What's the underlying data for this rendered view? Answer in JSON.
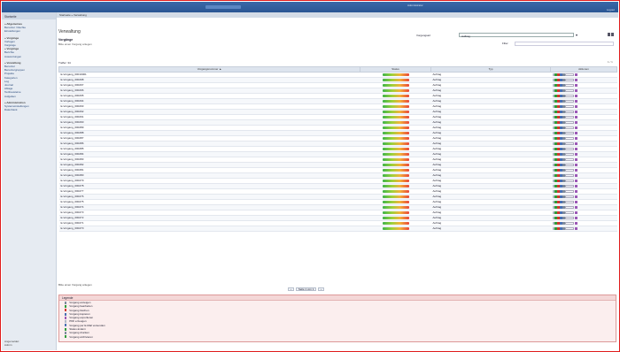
{
  "header": {
    "center_badge": "",
    "user_line1": "Administrator",
    "user_line2": "",
    "right_line1": "",
    "right_line2": "Logout"
  },
  "sidebar": {
    "head": "Startseite",
    "groups": [
      {
        "items": [
          "» Allgemeines",
          "Benutzer / Rechte",
          "Einstellungen"
        ]
      },
      {
        "items": [
          "» Vorgänge",
          "Vorlagen",
          "Vorgänge",
          "» Vorgänge",
          "Berichte",
          "Auswertungen"
        ]
      },
      {
        "items": [
          "» Verwaltung",
          "Benutzer",
          "Benutzergruppen",
          "Projekte",
          "Kategorien",
          "Log",
          "Journal",
          "Ablage",
          "Textbausteine",
          "Aufgaben"
        ]
      },
      {
        "items": [
          "» Administration",
          "Systemeinstellungen",
          "Datenbank"
        ]
      }
    ],
    "footer": [
      "Angemeldet:",
      "Admin"
    ]
  },
  "breadcrumb": "Startseite » Verwaltung",
  "page": {
    "title": "Verwaltung",
    "section": "Vorgänge",
    "subtitle": "Bitte einen Vorgang anlegen",
    "filter_label": "Vorgangsart",
    "filter_value": "Auftrag",
    "filter2_label": "Filter",
    "count_label": "Treffer: 34",
    "pager_top": "1 / 1"
  },
  "table": {
    "columns": [
      "Vorgangsnummer ▲",
      "Status",
      "Typ",
      "Aktionen"
    ],
    "type_value": "Auftrag",
    "rows": [
      "E-Vorgang_00010001",
      "E-Vorgang_000298",
      "E-Vorgang_000297",
      "E-Vorgang_000296",
      "E-Vorgang_000295",
      "E-Vorgang_000294",
      "E-Vorgang_000293",
      "E-Vorgang_000292",
      "E-Vorgang_000291",
      "E-Vorgang_000290",
      "E-Vorgang_000289",
      "E-Vorgang_000288",
      "E-Vorgang_000287",
      "E-Vorgang_000286",
      "E-Vorgang_000285",
      "E-Vorgang_000284",
      "E-Vorgang_000283",
      "E-Vorgang_000282",
      "E-Vorgang_000281",
      "E-Vorgang_000280",
      "E-Vorgang_000279",
      "E-Vorgang_000278",
      "E-Vorgang_000277",
      "E-Vorgang_000276",
      "E-Vorgang_000275",
      "E-Vorgang_000274",
      "E-Vorgang_000273",
      "E-Vorgang_000272",
      "E-Vorgang_000271",
      "E-Vorgang_000270"
    ]
  },
  "below_table": "Bitte einen Vorgang anlegen",
  "pager": {
    "prev": "‹",
    "label": "Seite 1 von 1",
    "next": "›"
  },
  "legend": {
    "title": "Legende",
    "items": [
      {
        "icon": "view-icon",
        "color": "#7d8a9b",
        "label": "Vorgang anzeigen"
      },
      {
        "icon": "edit-icon",
        "color": "#2f9c3a",
        "label": "Vorgang bearbeiten"
      },
      {
        "icon": "delete-icon",
        "color": "#d33a2f",
        "label": "Vorgang löschen"
      },
      {
        "icon": "copy-icon",
        "color": "#4a6fb3",
        "label": "Vorgang kopieren"
      },
      {
        "icon": "export-icon",
        "color": "#9b59b6",
        "label": "Vorgang exportieren"
      },
      {
        "icon": "pdf-icon",
        "color": "#b0b9c6",
        "label": "PDF erzeugen"
      },
      {
        "icon": "mail-icon",
        "color": "#4a6fb3",
        "label": "Vorgang per E-Mail versenden"
      },
      {
        "icon": "status-icon",
        "color": "#2f9c3a",
        "label": "Status ändern"
      },
      {
        "icon": "print-icon",
        "color": "#7d8a9b",
        "label": "Vorgang drucken"
      },
      {
        "icon": "archive-icon",
        "color": "#2f9c3a",
        "label": "Vorgang archivieren"
      }
    ]
  }
}
